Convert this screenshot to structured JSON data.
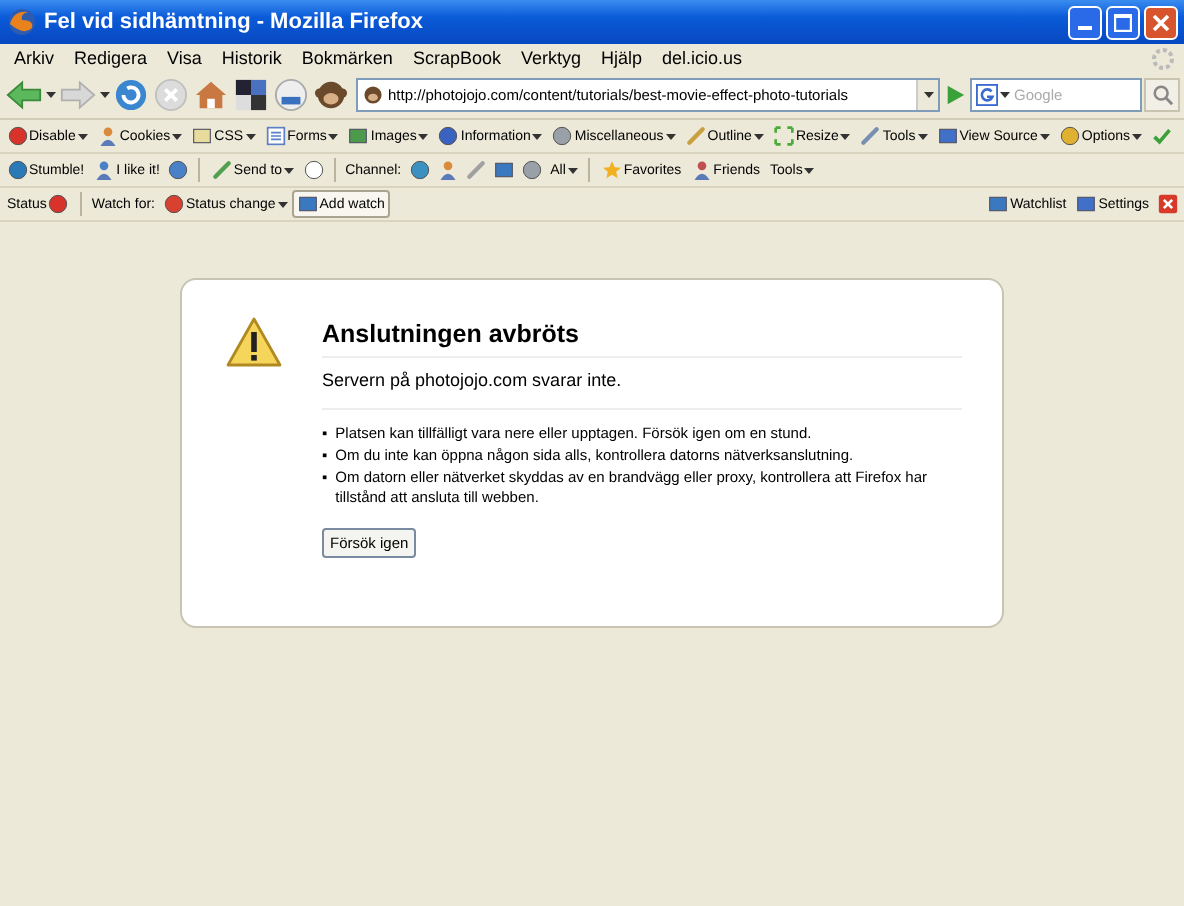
{
  "window": {
    "title": "Fel vid sidhämtning - Mozilla Firefox"
  },
  "menu": [
    "Arkiv",
    "Redigera",
    "Visa",
    "Historik",
    "Bokmärken",
    "ScrapBook",
    "Verktyg",
    "Hjälp",
    "del.icio.us"
  ],
  "nav": {
    "url": "http://photojojo.com/content/tutorials/best-movie-effect-photo-tutorials",
    "search_placeholder": "Google"
  },
  "webdev_toolbar": [
    {
      "kind": "button",
      "label": "Disable",
      "dropdown": true
    },
    {
      "kind": "button",
      "label": "Cookies",
      "dropdown": true
    },
    {
      "kind": "button",
      "label": "CSS",
      "dropdown": true
    },
    {
      "kind": "button",
      "label": "Forms",
      "dropdown": true
    },
    {
      "kind": "button",
      "label": "Images",
      "dropdown": true
    },
    {
      "kind": "button",
      "label": "Information",
      "dropdown": true
    },
    {
      "kind": "button",
      "label": "Miscellaneous",
      "dropdown": true
    },
    {
      "kind": "button",
      "label": "Outline",
      "dropdown": true
    },
    {
      "kind": "button",
      "label": "Resize",
      "dropdown": true
    },
    {
      "kind": "button",
      "label": "Tools",
      "dropdown": true
    },
    {
      "kind": "button",
      "label": "View Source",
      "dropdown": true
    },
    {
      "kind": "button",
      "label": "Options",
      "dropdown": true
    },
    {
      "kind": "button",
      "dropdown": false
    }
  ],
  "stumble_toolbar": [
    {
      "kind": "button",
      "label": "Stumble!",
      "dropdown": false
    },
    {
      "kind": "button",
      "label": "I like it!",
      "dropdown": false
    },
    {
      "kind": "button",
      "dropdown": false
    },
    {
      "kind": "separator"
    },
    {
      "kind": "button",
      "label": "Send to",
      "dropdown": true
    },
    {
      "kind": "button",
      "dropdown": false
    },
    {
      "kind": "separator"
    },
    {
      "kind": "label",
      "label": "Channel:"
    },
    {
      "kind": "button",
      "dropdown": false
    },
    {
      "kind": "button",
      "dropdown": false
    },
    {
      "kind": "button",
      "dropdown": false
    },
    {
      "kind": "button",
      "dropdown": false
    },
    {
      "kind": "button",
      "dropdown": false
    },
    {
      "kind": "button",
      "label": "All",
      "dropdown": true
    },
    {
      "kind": "separator"
    },
    {
      "kind": "button",
      "label": "Favorites",
      "dropdown": false
    },
    {
      "kind": "button",
      "label": "Friends",
      "dropdown": false
    },
    {
      "kind": "button",
      "label": "Tools",
      "dropdown": true
    }
  ],
  "status_toolbar": {
    "left": [
      {
        "kind": "button",
        "label": "Status",
        "dropdown": false,
        "pressed": false
      },
      {
        "kind": "separator"
      },
      {
        "kind": "label",
        "label": "Watch for:"
      },
      {
        "kind": "button",
        "label": "Status change",
        "dropdown": true,
        "pressed": false
      },
      {
        "kind": "button",
        "label": "Add watch",
        "dropdown": false,
        "pressed": true
      }
    ],
    "right": [
      {
        "kind": "button",
        "label": "Watchlist",
        "dropdown": false,
        "pressed": false
      },
      {
        "kind": "button",
        "label": "Settings",
        "dropdown": false,
        "pressed": false
      },
      {
        "kind": "button",
        "dropdown": false,
        "pressed": false
      }
    ]
  },
  "error": {
    "title": "Anslutningen avbröts",
    "message": "Servern på photojojo.com svarar inte.",
    "bullets": [
      {
        "marker": "▪",
        "text": "Platsen kan tillfälligt vara nere eller upptagen. Försök igen om en stund."
      },
      {
        "marker": "▪",
        "text": "Om du inte kan öppna någon sida alls, kontrollera datorns nätverksanslutning."
      },
      {
        "marker": "▪",
        "text": "Om datorn eller nätverket skyddas av en brandvägg eller proxy, kontrollera att Firefox har tillstånd att ansluta till webben."
      }
    ],
    "button": "Försök igen"
  }
}
